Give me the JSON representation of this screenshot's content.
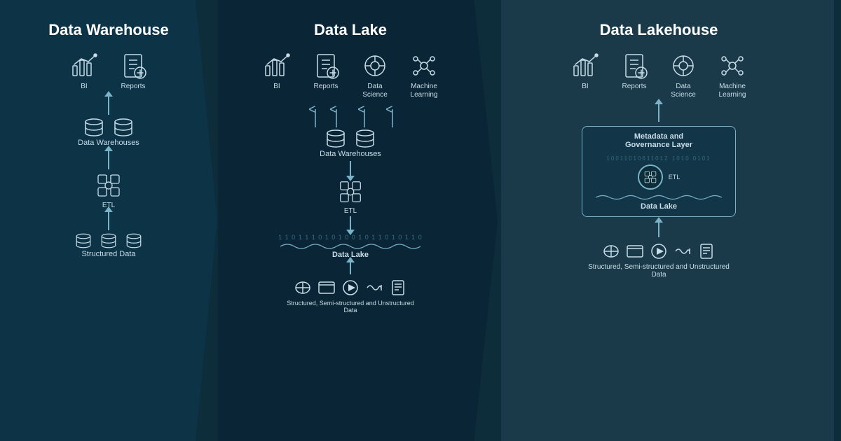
{
  "warehouse": {
    "title": "Data Warehouse",
    "top_icons": [
      {
        "label": "BI"
      },
      {
        "label": "Reports"
      }
    ],
    "mid_label": "Data Warehouses",
    "etl_label": "ETL",
    "bottom_label": "Structured Data"
  },
  "lake": {
    "title": "Data Lake",
    "top_icons": [
      {
        "label": "BI"
      },
      {
        "label": "Reports"
      },
      {
        "label": "Data\nScience"
      },
      {
        "label": "Machine\nLearning"
      }
    ],
    "mid_label": "Data Warehouses",
    "etl_label": "ETL",
    "datalake_label": "Data Lake",
    "binary": "1101110101001011010110",
    "bottom_label": "Structured, Semi-structured and Unstructured Data"
  },
  "lakehouse": {
    "title": "Data Lakehouse",
    "top_icons": [
      {
        "label": "BI"
      },
      {
        "label": "Reports"
      },
      {
        "label": "Data\nScience"
      },
      {
        "label": "Machine\nLearning"
      }
    ],
    "meta_label": "Metadata and\nGovernance Layer",
    "etl_label": "ETL",
    "datalake_label": "Data Lake",
    "binary": "10011010611012",
    "bottom_label": "Structured, Semi-structured\nand Unstructured Data"
  }
}
